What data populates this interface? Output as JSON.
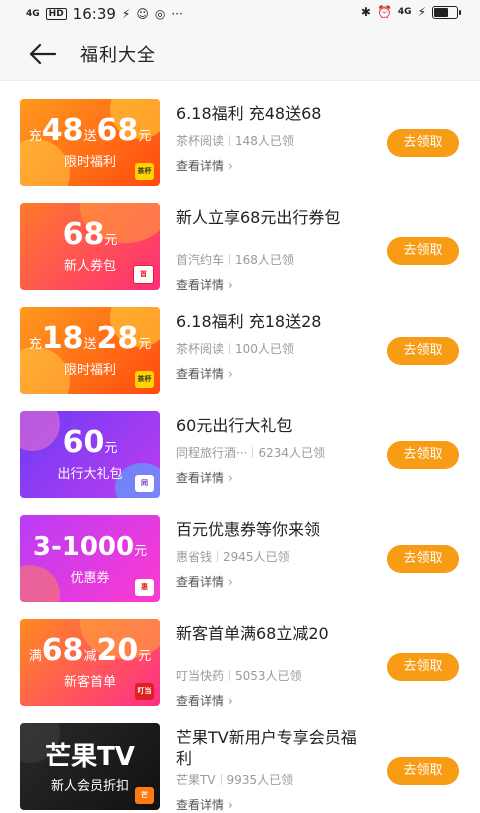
{
  "status_bar": {
    "network": "4G",
    "hd": "HD",
    "time": "16:39",
    "more": "···",
    "right_network": "4G"
  },
  "header": {
    "title": "福利大全"
  },
  "items": [
    {
      "thumb_prefix": "充",
      "thumb_value1": "48",
      "thumb_mid": "送",
      "thumb_value2": "68",
      "thumb_unit": "元",
      "thumb_sub": "限时福利",
      "logo": "茶杯",
      "title": "6.18福利 充48送68",
      "vendor": "茶杯阅读",
      "claimed": "148人已领",
      "detail": "查看详情",
      "button": "去领取"
    },
    {
      "thumb_value1": "68",
      "thumb_unit": "元",
      "thumb_sub": "新人券包",
      "logo": "首",
      "title": "新人立享68元出行券包",
      "vendor": "首汽约车",
      "claimed": "168人已领",
      "detail": "查看详情",
      "button": "去领取"
    },
    {
      "thumb_prefix": "充",
      "thumb_value1": "18",
      "thumb_mid": "送",
      "thumb_value2": "28",
      "thumb_unit": "元",
      "thumb_sub": "限时福利",
      "logo": "茶杯",
      "title": "6.18福利 充18送28",
      "vendor": "茶杯阅读",
      "claimed": "100人已领",
      "detail": "查看详情",
      "button": "去领取"
    },
    {
      "thumb_value1": "60",
      "thumb_unit": "元",
      "thumb_sub": "出行大礼包",
      "logo": "同",
      "title": "60元出行大礼包",
      "vendor": "同程旅行酒···",
      "claimed": "6234人已领",
      "detail": "查看详情",
      "button": "去领取"
    },
    {
      "thumb_value1": "3-1000",
      "thumb_unit": "元",
      "thumb_sub": "优惠券",
      "logo": "惠",
      "title": "百元优惠券等你来领",
      "vendor": "惠省钱",
      "claimed": "2945人已领",
      "detail": "查看详情",
      "button": "去领取"
    },
    {
      "thumb_prefix": "满",
      "thumb_value1": "68",
      "thumb_mid": "减",
      "thumb_value2": "20",
      "thumb_unit": "元",
      "thumb_sub": "新客首单",
      "logo": "叮当",
      "title": "新客首单满68立减20",
      "vendor": "叮当快药",
      "claimed": "5053人已领",
      "detail": "查看详情",
      "button": "去领取"
    },
    {
      "thumb_value1": "芒果TV",
      "thumb_sub": "新人会员折扣",
      "logo": "芒",
      "title": "芒果TV新用户专享会员福利",
      "vendor": "芒果TV",
      "claimed": "9935人已领",
      "detail": "查看详情",
      "button": "去领取"
    }
  ],
  "colors": {
    "accent_button": "#f79c14",
    "orange_card": "#ff7a12",
    "pink_card": "#ff3d7f",
    "purple_card": "#8a3cf0",
    "magenta_card": "#e83ad6",
    "dark_card": "#1e1e1e"
  }
}
